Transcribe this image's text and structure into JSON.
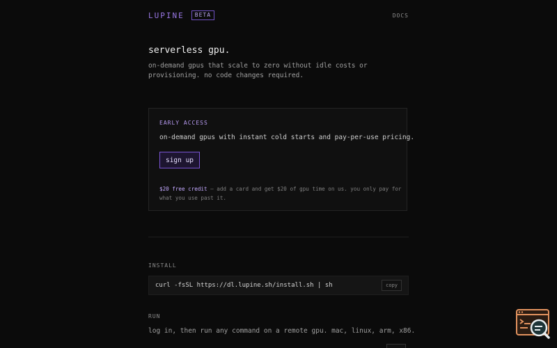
{
  "header": {
    "logo": "LUPINE",
    "badge": "BETA",
    "docs_link": "DOCS"
  },
  "hero": {
    "title": "serverless gpu.",
    "subtitle": "on-demand gpus that scale to zero without idle costs or provisioning. no code changes required."
  },
  "early_access": {
    "label": "EARLY ACCESS",
    "description": "on-demand gpus with instant cold starts and pay-per-use pricing.",
    "signup_label": "sign up",
    "credit_highlight": "$20 free credit",
    "credit_text": " — add a card and get $20 of gpu time on us. you only pay for what you use past it."
  },
  "install": {
    "label": "INSTALL",
    "command": "curl -fsSL https://dl.lupine.sh/install.sh | sh",
    "copy_label": "copy"
  },
  "run": {
    "label": "RUN",
    "description": "log in, then run any command on a remote gpu. mac, linux, arm, x86."
  },
  "colors": {
    "background": "#0b0b0b",
    "accent": "#9a78e6",
    "widget": "#e3935f"
  },
  "icons": {
    "floating_widget": "terminal-search-icon"
  }
}
